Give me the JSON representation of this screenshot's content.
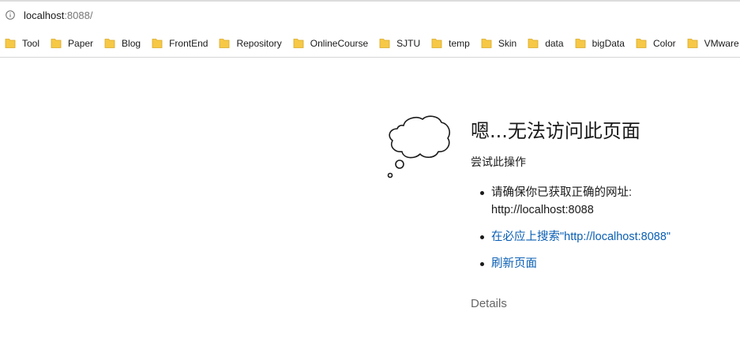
{
  "address_bar": {
    "icon": "info-icon",
    "url_host": "localhost",
    "url_rest": ":8088/"
  },
  "bookmarks": [
    {
      "label": "Tool",
      "icon": "folder-icon"
    },
    {
      "label": "Paper",
      "icon": "folder-icon"
    },
    {
      "label": "Blog",
      "icon": "folder-icon"
    },
    {
      "label": "FrontEnd",
      "icon": "folder-icon"
    },
    {
      "label": "Repository",
      "icon": "folder-icon"
    },
    {
      "label": "OnlineCourse",
      "icon": "folder-icon"
    },
    {
      "label": "SJTU",
      "icon": "folder-icon"
    },
    {
      "label": "temp",
      "icon": "folder-icon"
    },
    {
      "label": "Skin",
      "icon": "folder-icon"
    },
    {
      "label": "data",
      "icon": "folder-icon"
    },
    {
      "label": "bigData",
      "icon": "folder-icon"
    },
    {
      "label": "Color",
      "icon": "folder-icon"
    },
    {
      "label": "VMware",
      "icon": "folder-icon"
    }
  ],
  "colors": {
    "folder": "#f6c845",
    "link": "#0a5fb4"
  },
  "error": {
    "illustration": "thought-cloud-icon",
    "title": "嗯...无法访问此页面",
    "subtitle": "尝试此操作",
    "tips": {
      "check_url_line1": "请确保你已获取正确的网址:",
      "check_url_line2": "http://localhost:8088",
      "search_link": "在必应上搜索\"http://localhost:8088\"",
      "refresh_link": "刷新页面"
    },
    "details_label": "Details"
  }
}
